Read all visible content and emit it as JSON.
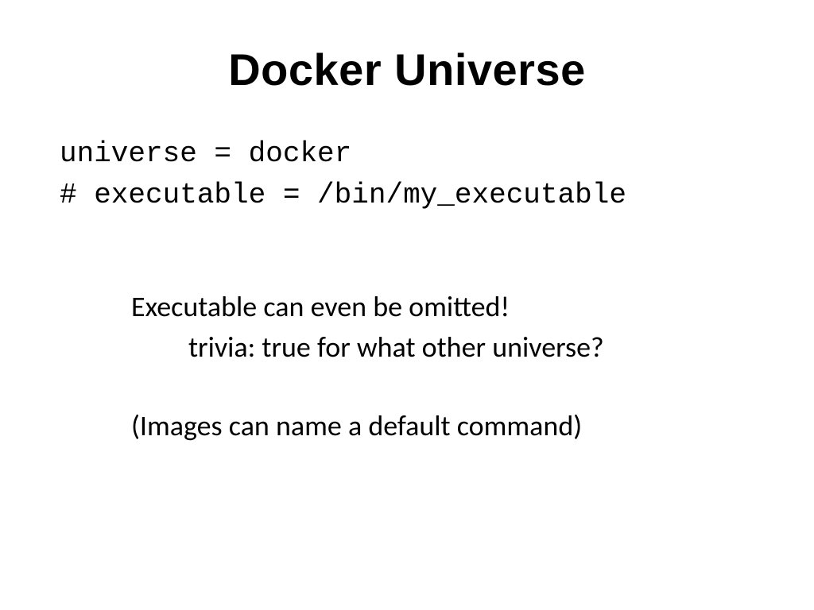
{
  "title": "Docker Universe",
  "code": {
    "line1": "universe = docker",
    "line2": "# executable = /bin/my_executable"
  },
  "body": {
    "line1": "Executable can even be omitted!",
    "line2": "trivia:  true for what other universe?",
    "line3": "(Images can name a default command)"
  }
}
